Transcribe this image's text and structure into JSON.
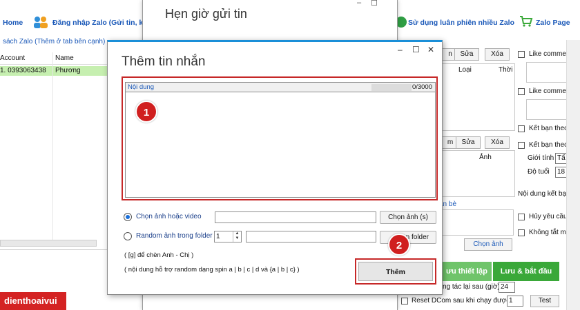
{
  "main_app": {
    "top_bar": {
      "home_label": "Home",
      "login_label": "Đăng nhập Zalo (Gửi tin, kết",
      "rotate_label": "Sử dụng luân phiên nhiều Zalo",
      "zalo_page_label": "Zalo Page"
    },
    "left_pane": {
      "title": "sách Zalo (Thêm ở tab bên cạnh)",
      "columns": [
        "Account",
        "Name"
      ],
      "rows": [
        {
          "account": "1. 0393063438",
          "name": "Phương"
        }
      ]
    },
    "right_pane": {
      "btn_add_top": "n",
      "btn_edit_top": "Sửa",
      "btn_delete_top": "Xóa",
      "col_type": "Loại",
      "col_time": "Thời",
      "like_comment_1": "Like commer",
      "like_comment_2": "Like commer",
      "btn_add_mid": "m",
      "btn_edit_mid": "Sửa",
      "btn_delete_mid": "Xóa",
      "col_image": "Ảnh",
      "add_friend_1": "Kết bạn theo",
      "add_friend_2": "Kết bạn theo",
      "gender_label": "Giới tính",
      "gender_value": "Tấ",
      "age_label": "Độ tuổi",
      "age_value": "18",
      "friend_content_label": "Nội dung kết bạ",
      "friend_list_label": "ạn bè",
      "cancel_request": "Hủy yêu cầu",
      "no_off": "Không tắt má",
      "choose_image": "Chọn ảnh",
      "save_settings": "ưu thiết lập",
      "save_start": "Lưu & bắt đầu",
      "repeat_label": "ng tác lại sau (giờ)",
      "repeat_value": "24",
      "reset_dcom_label": "Reset DCom sau khi chạy được",
      "reset_dcom_value": "1",
      "test_button": "Test"
    }
  },
  "schedule_dialog": {
    "title": "Hẹn giờ gửi tin",
    "controls": [
      "–",
      "☐"
    ]
  },
  "add_dialog": {
    "title": "Thêm tin nhắn",
    "controls": {
      "minimize": "–",
      "maximize": "☐",
      "close": "✕"
    },
    "content_label": "Nội dung",
    "char_count": "0/3000",
    "content_value": "",
    "option_choose_media": "Chọn ảnh hoặc video",
    "option_random_folder": "Random ảnh trong folder",
    "random_count_value": "1",
    "choose_image_button": "Chọn ảnh (s)",
    "choose_folder_button": "n folder",
    "hint_name": "( [g] để chèn Anh - Chị )",
    "hint_spin": "( nội dung hỗ trợ random dạng spin a | b | c | d và {a | b | c} )",
    "add_button": "Thêm"
  },
  "annotations": {
    "badge_1": "1",
    "badge_2": "2"
  },
  "brand": {
    "label": "dienthoaivui"
  },
  "colors": {
    "accent_blue": "#1a8fd8",
    "highlight_red": "#c62828",
    "badge_red": "#d01f1f",
    "green": "#3aa839",
    "row_green": "#c6efb0"
  }
}
